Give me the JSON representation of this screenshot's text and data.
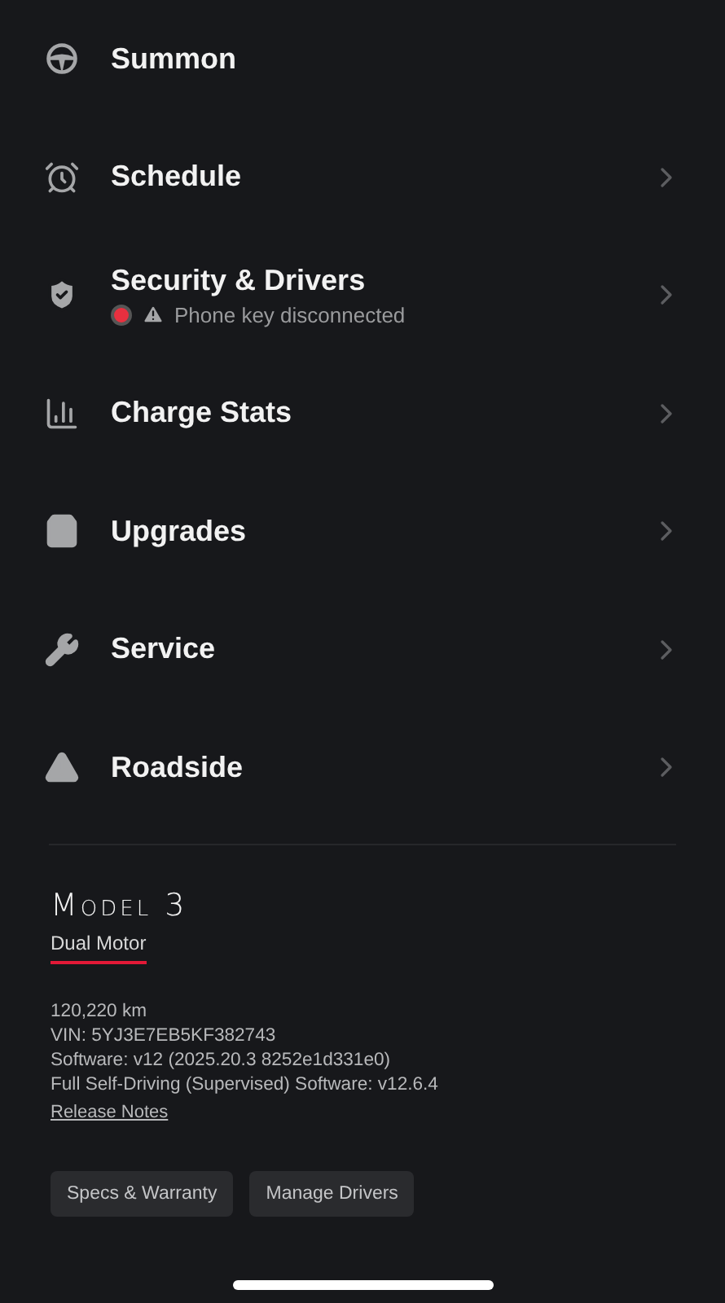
{
  "menu": [
    {
      "kind": "summon",
      "label": "Summon",
      "chevron": false
    },
    {
      "kind": "schedule",
      "label": "Schedule",
      "chevron": true
    },
    {
      "kind": "security",
      "label": "Security & Drivers",
      "chevron": true,
      "status": {
        "alert": true,
        "text": "Phone key disconnected"
      }
    },
    {
      "kind": "stats",
      "label": "Charge Stats",
      "chevron": true
    },
    {
      "kind": "upgrades",
      "label": "Upgrades",
      "chevron": true
    },
    {
      "kind": "service",
      "label": "Service",
      "chevron": true
    },
    {
      "kind": "roadside",
      "label": "Roadside",
      "chevron": true
    }
  ],
  "vehicle": {
    "model": "Model 3",
    "tabs": [
      {
        "label": "Dual Motor",
        "selected": true
      }
    ],
    "details": [
      "120,220 km",
      "VIN: 5YJ3E7EB5KF382743",
      "Software: v12 (2025.20.3 8252e1d331e0)",
      "Full Self-Driving (Supervised) Software: v12.6.4"
    ],
    "link": "Release Notes",
    "buttons": [
      "Specs & Warranty",
      "Manage Drivers"
    ]
  }
}
